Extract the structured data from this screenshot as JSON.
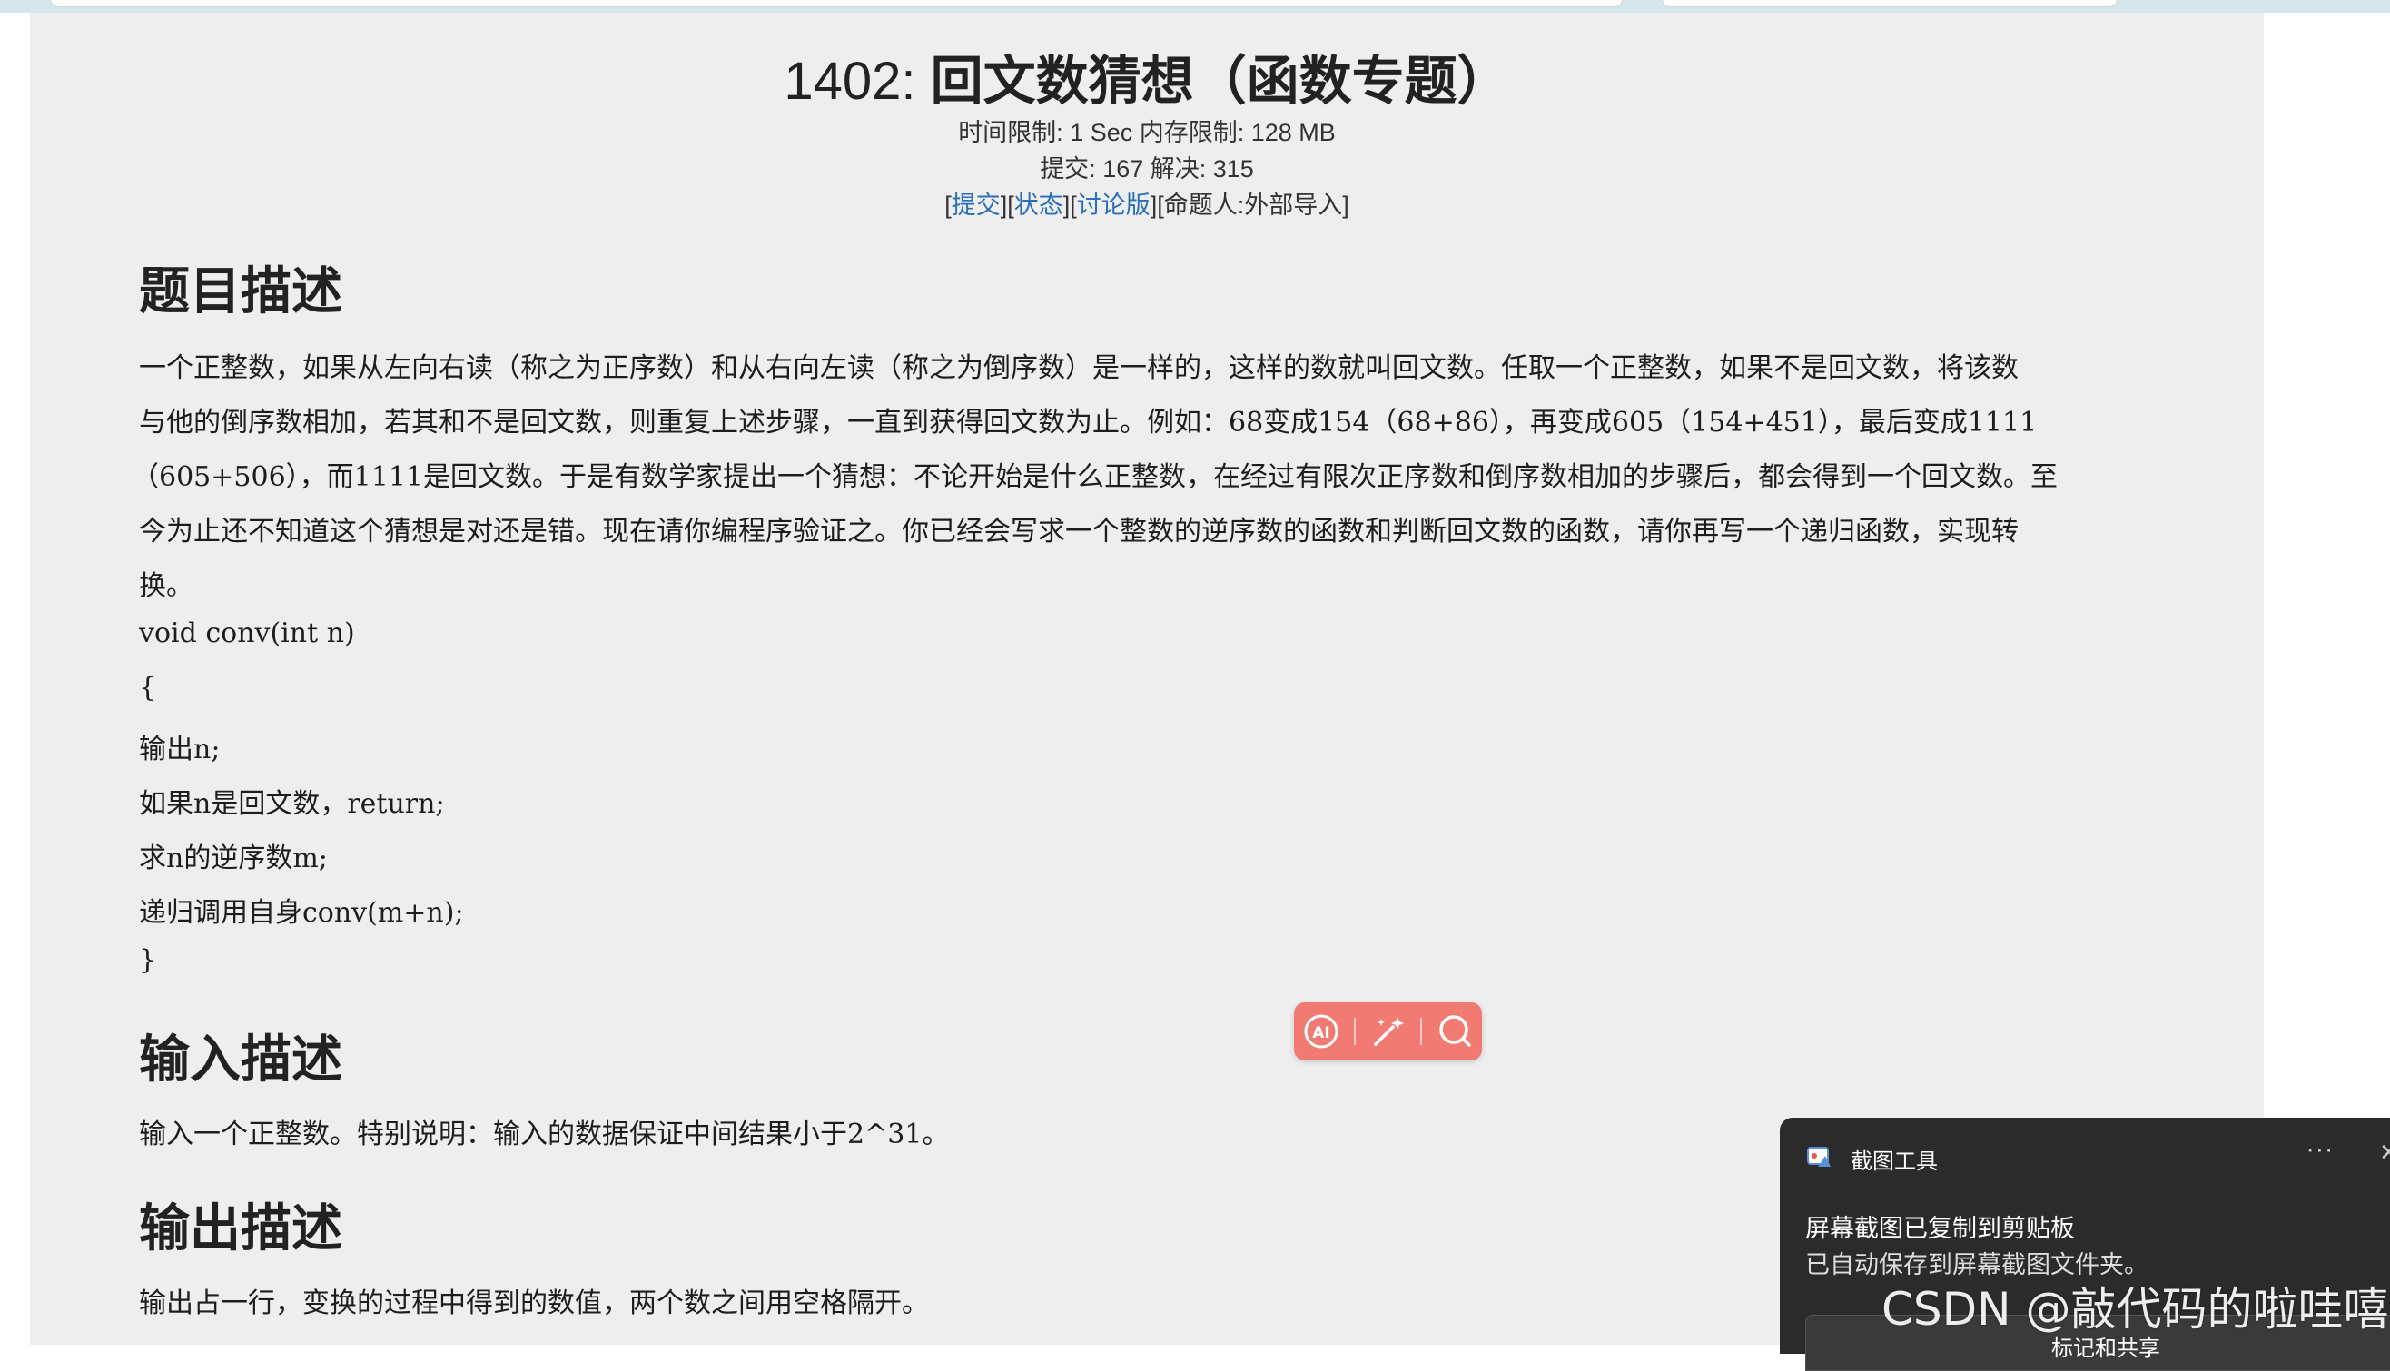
{
  "problem": {
    "title_num": "1402: ",
    "title_text": "回文数猜想（函数专题）",
    "meta_line1": "时间限制: 1 Sec  内存限制: 128 MB",
    "meta_line2": "提交: 167  解决: 315",
    "links": {
      "submit": "提交",
      "status": "状态",
      "discuss": "讨论版",
      "author": "[命题人:外部导入]"
    }
  },
  "sections": {
    "description_heading": "题目描述",
    "description_lines": [
      "一个正整数，如果从左向右读（称之为正序数）和从右向左读（称之为倒序数）是一样的，这样的数就叫回文数。任取一个正整数，如果不是回文数，将该数",
      "与他的倒序数相加，若其和不是回文数，则重复上述步骤，一直到获得回文数为止。例如：68变成154（68+86），再变成605（154+451），最后变成1111",
      "（605+506），而1111是回文数。于是有数学家提出一个猜想：不论开始是什么正整数，在经过有限次正序数和倒序数相加的步骤后，都会得到一个回文数。至",
      "今为止还不知道这个猜想是对还是错。现在请你编程序验证之。你已经会写求一个整数的逆序数的函数和判断回文数的函数，请你再写一个递归函数，实现转",
      "换。"
    ],
    "code_lines": [
      "void conv(int n)",
      "{",
      "输出n;",
      "如果n是回文数，return;",
      "求n的逆序数m;",
      "递归调用自身conv(m+n);",
      "}"
    ],
    "input_heading": "输入描述",
    "input_text": "输入一个正整数。特别说明：输入的数据保证中间结果小于2^31。",
    "output_heading": "输出描述",
    "output_text": "输出占一行，变换的过程中得到的数值，两个数之间用空格隔开。"
  },
  "floating_toolbar": {
    "icons": [
      "ai-icon",
      "magic-wand-icon",
      "search-icon"
    ],
    "color": "#f17a72"
  },
  "toast": {
    "app_name": "截图工具",
    "more": "···",
    "close": "✕",
    "message_title": "屏幕截图已复制到剪贴板",
    "message_body": "已自动保存到屏幕截图文件夹。",
    "action_label": "标记和共享"
  },
  "watermark": "CSDN @敲代码的啦哇嘻"
}
